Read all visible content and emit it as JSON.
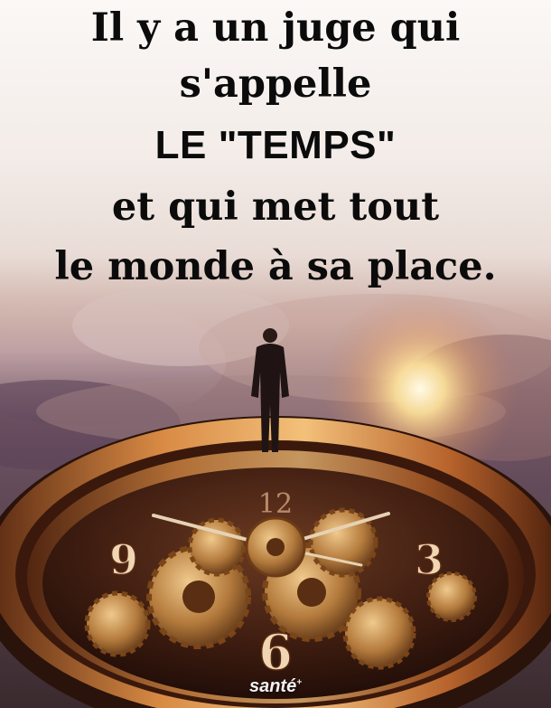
{
  "quote": {
    "line1": "Il y a un juge qui",
    "line2": "s'appelle",
    "line3": "LE \"TEMPS\"",
    "line4": "et qui met tout",
    "line5": "le monde à sa place."
  },
  "clock": {
    "numeral_12": "12",
    "numeral_9": "9",
    "numeral_3": "3",
    "numeral_6": "6"
  },
  "watermark": "santé",
  "colors": {
    "sun": "#fff4c2",
    "bronze": "#c8843c",
    "text": "#0b0b0b"
  }
}
